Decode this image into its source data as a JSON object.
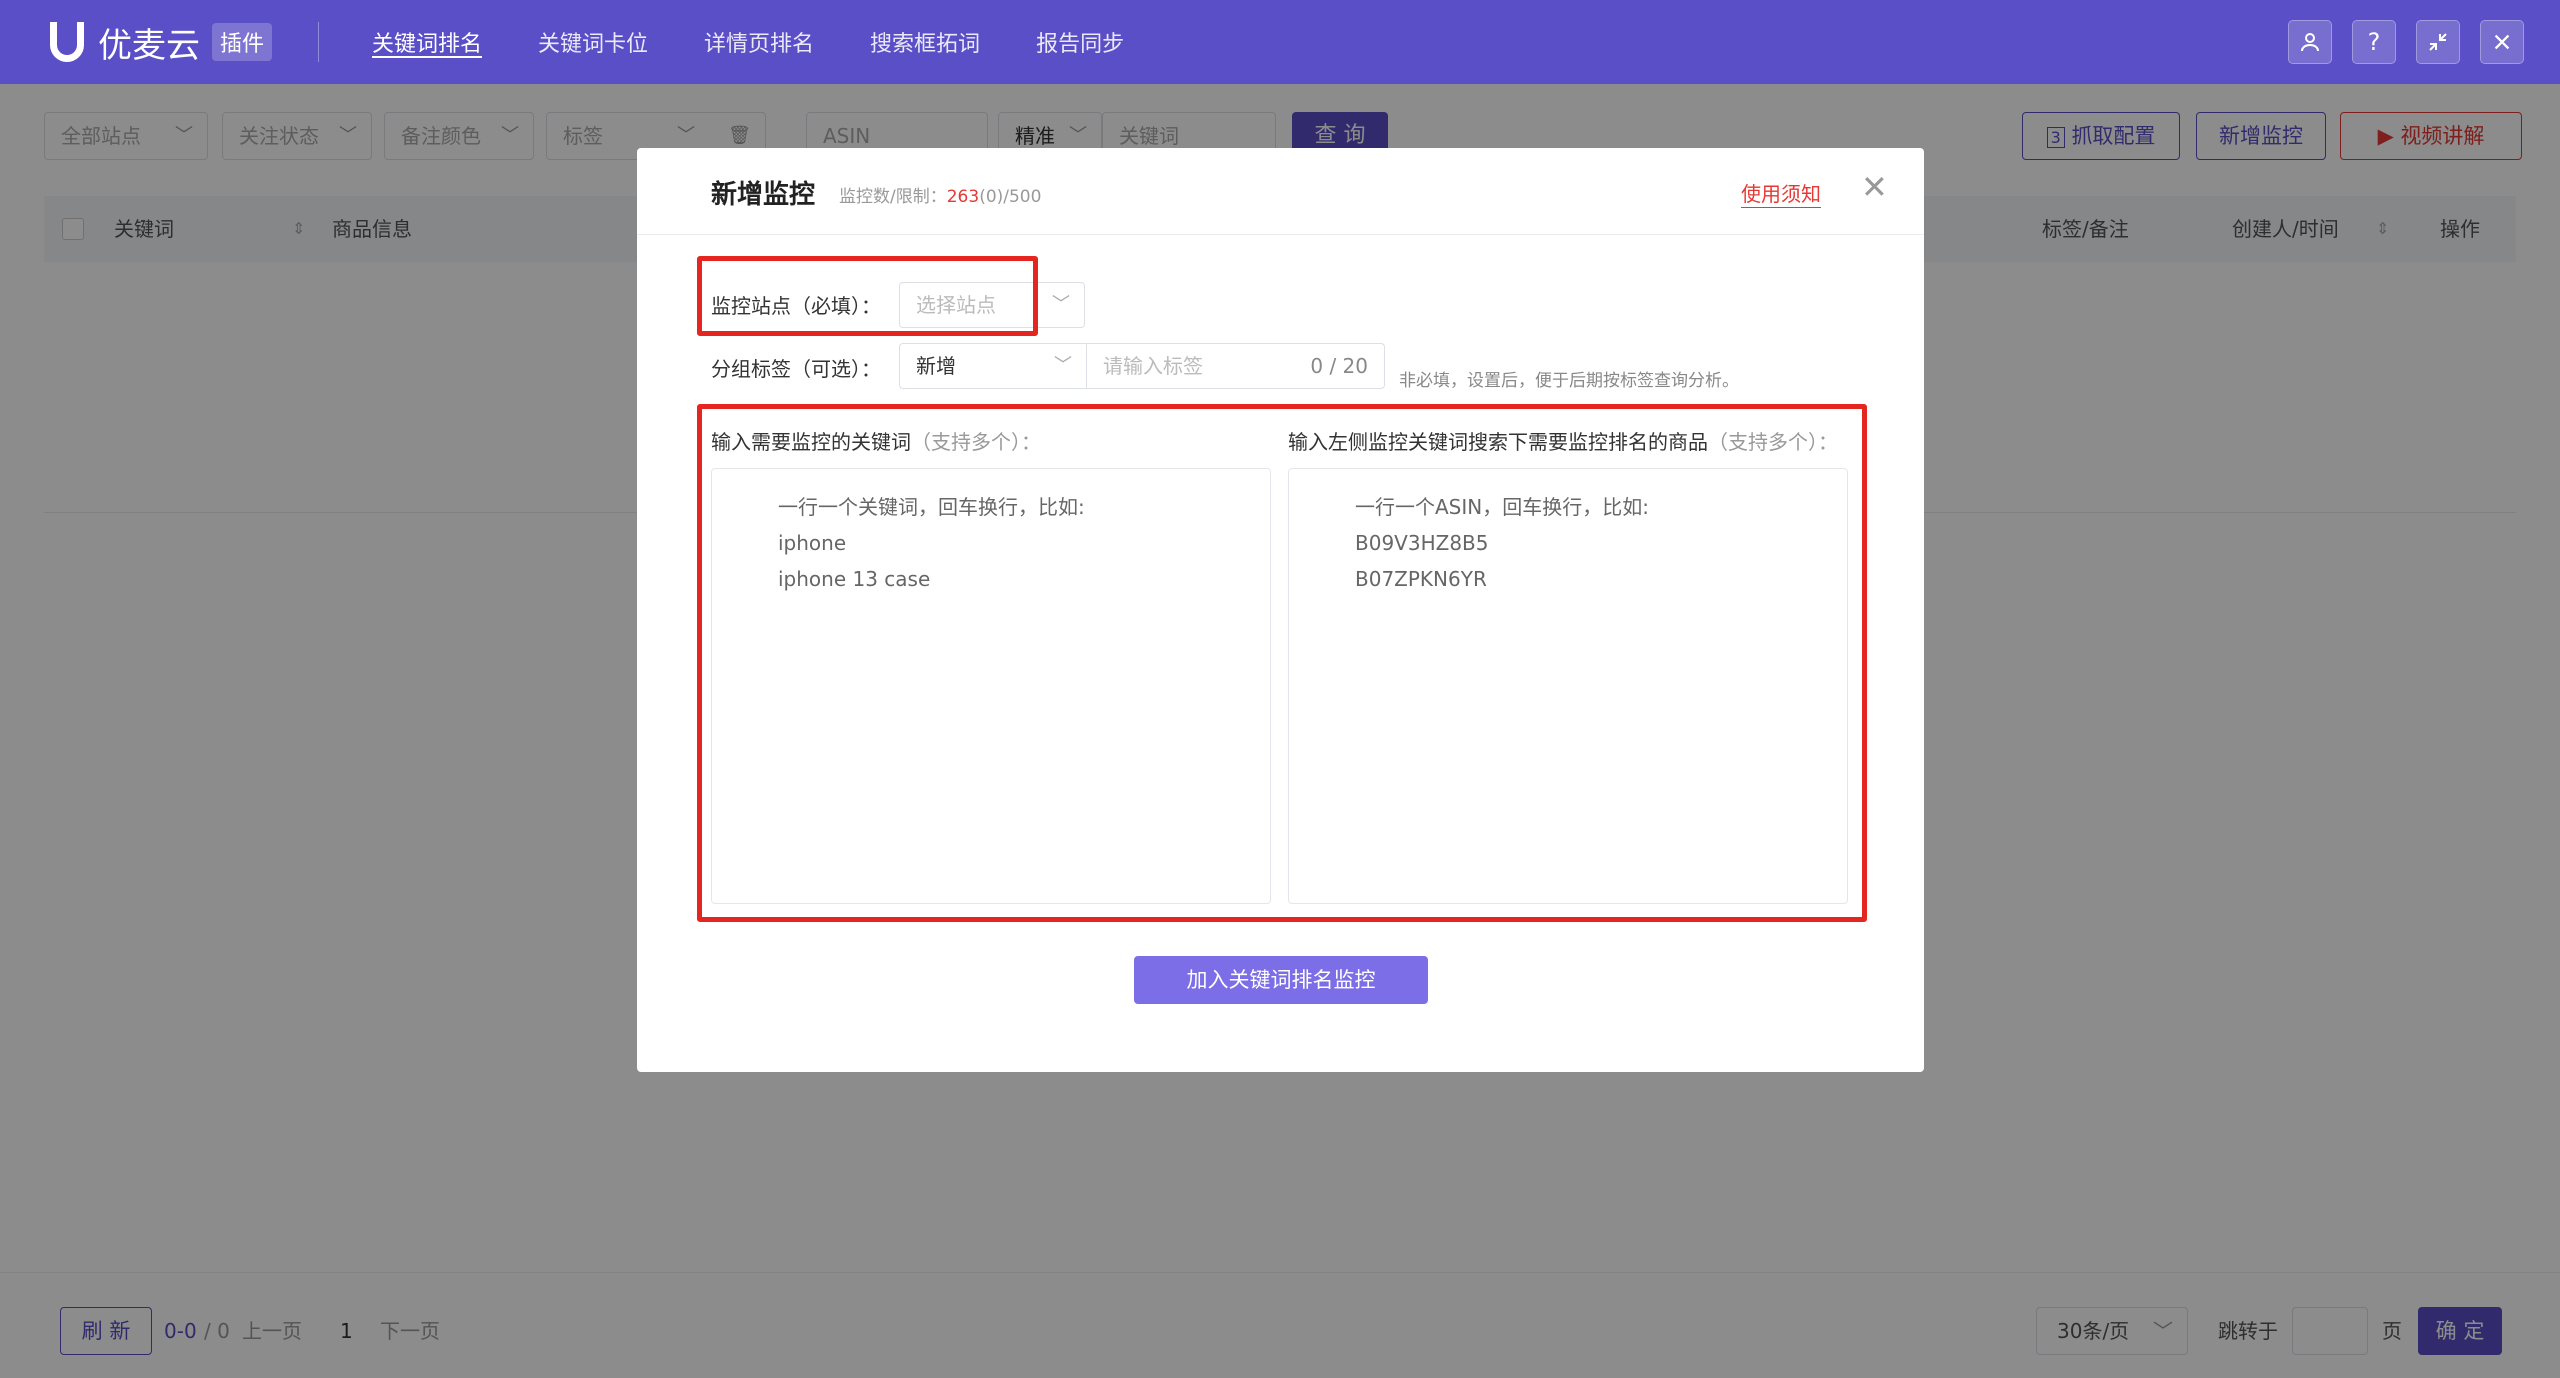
{
  "header": {
    "logo_name": "优麦云",
    "logo_badge": "插件",
    "nav": [
      {
        "label": "关键词排名",
        "active": true
      },
      {
        "label": "关键词卡位",
        "active": false
      },
      {
        "label": "详情页排名",
        "active": false
      },
      {
        "label": "搜索框拓词",
        "active": false
      },
      {
        "label": "报告同步",
        "active": false
      }
    ],
    "icons": [
      "user-icon",
      "help-icon",
      "collapse-icon",
      "close-icon"
    ]
  },
  "filters": {
    "site": "全部站点",
    "follow_status": "关注状态",
    "note_color": "备注颜色",
    "tag": "标签",
    "asin_placeholder": "ASIN",
    "match_mode": "精准",
    "keyword_placeholder": "关键词",
    "query_button": "查 询",
    "capture_config": "抓取配置",
    "add_monitor": "新增监控",
    "video_tutorial": "视频讲解"
  },
  "table_header": {
    "keyword": "关键词",
    "product_info": "商品信息",
    "tag_note": "标签/备注",
    "creator_time": "创建人/时间",
    "actions": "操作"
  },
  "pagination": {
    "refresh": "刷 新",
    "range": "0-0",
    "total": "/ 0",
    "prev": "上一页",
    "page": "1",
    "next": "下一页",
    "page_size": "30条/页",
    "jump_to": "跳转于",
    "page_unit": "页",
    "confirm": "确 定"
  },
  "modal": {
    "title": "新增监控",
    "limit_label": "监控数/限制：",
    "limit_used": "263",
    "limit_rest": "(0)/500",
    "notice_link": "使用须知",
    "site_label": "监控站点（必填）：",
    "site_placeholder": "选择站点",
    "group_label": "分组标签（可选）：",
    "group_value": "新增",
    "tag_placeholder": "请输入标签",
    "tag_count": "0 / 20",
    "tag_hint": "非必填，设置后，便于后期按标签查询分析。",
    "keywords_title": "输入需要监控的关键词",
    "keywords_note": "（支持多个）：",
    "keywords_lines": [
      "一行一个关键词，回车换行，比如:",
      "iphone",
      "iphone 13 case"
    ],
    "products_title": "输入左侧监控关键词搜索下需要监控排名的商品",
    "products_note": "（支持多个）：",
    "products_lines": [
      "一行一个ASIN，回车换行，比如:",
      "B09V3HZ8B5",
      "B07ZPKN6YR"
    ],
    "submit": "加入关键词排名监控"
  },
  "colors": {
    "brand": "#5a4fc6",
    "highlight": "#e5251f",
    "danger": "#e53935"
  }
}
